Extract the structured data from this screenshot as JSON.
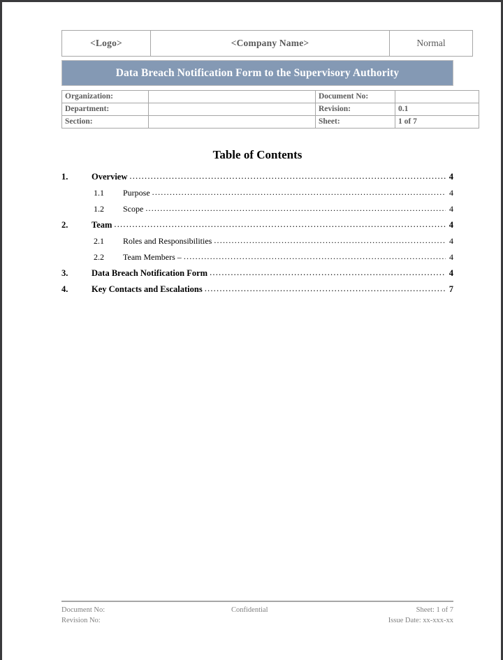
{
  "document": {
    "header": {
      "logo_cell": "<Logo>",
      "company_cell": "<Company Name>",
      "status_cell": "Normal"
    },
    "banner": {
      "title": "Data Breach Notification Form to the Supervisory Authority"
    },
    "meta": {
      "rows": [
        {
          "label": "Organization:",
          "value": "",
          "label2": "Document No:",
          "value2": ""
        },
        {
          "label": "Department:",
          "value": "",
          "label2": "Revision:",
          "value2": "0.1"
        },
        {
          "label": "Section:",
          "value": "",
          "label2": "Sheet:",
          "value2": "1 of 7"
        }
      ]
    },
    "toc": {
      "heading": "Table of Contents",
      "leader": "...........................................................................................................................................................................................",
      "entries": [
        {
          "level": 1,
          "number": "1.",
          "title": "Overview",
          "page": "4"
        },
        {
          "level": 2,
          "number": "1.1",
          "title": "Purpose",
          "page": "4"
        },
        {
          "level": 2,
          "number": "1.2",
          "title": "Scope",
          "page": "4"
        },
        {
          "level": 1,
          "number": "2.",
          "title": "Team",
          "page": "4"
        },
        {
          "level": 2,
          "number": "2.1",
          "title": "Roles and Responsibilities",
          "page": "4"
        },
        {
          "level": 2,
          "number": "2.2",
          "title": "Team Members –",
          "page": "4"
        },
        {
          "level": 1,
          "number": "3.",
          "title": "Data Breach Notification Form",
          "page": "4"
        },
        {
          "level": 1,
          "number": "4.",
          "title": "Key Contacts and Escalations",
          "page": "7"
        }
      ]
    },
    "footer": {
      "left_line1": "Document No:",
      "left_line2": "Revision No:",
      "center": "Confidential",
      "right_line1": "Sheet: 1 of 7",
      "right_line2": "Issue Date: xx-xxx-xx"
    },
    "colors": {
      "banner_bg": "#8499b4",
      "banner_text": "#ffffff",
      "table_border": "#a6a6a6",
      "meta_text": "#5b5b5b",
      "footer_text": "#808080"
    }
  }
}
